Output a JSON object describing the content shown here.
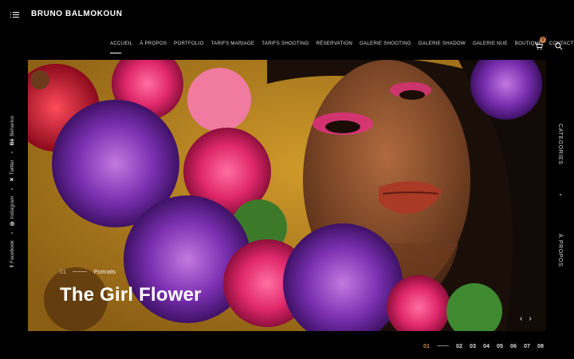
{
  "header": {
    "brand": "BRUNO BALMOKOUN",
    "nav": [
      "ACCUEIL",
      "À PROPOS",
      "PORTFOLIO",
      "TARIFS MARIAGE",
      "TARIFS SHOOTING",
      "RÉSERVATION",
      "GALERIE SHOOTING",
      "GALERIE SHADOW",
      "GALERIE NUE",
      "BOUTIQUE",
      "CONTACT"
    ],
    "cart_count": "0"
  },
  "social": [
    {
      "icon": "f",
      "label": "Facebook"
    },
    {
      "icon": "◎",
      "label": "Instagram"
    },
    {
      "icon": "✕",
      "label": "Twitter"
    },
    {
      "icon": "Bē",
      "label": "Behance"
    }
  ],
  "right_rail": {
    "top": "CATEGORIES",
    "bottom": "À PROPOS"
  },
  "slide": {
    "number": "01",
    "category": "Portraits",
    "title": "The Girl Flower"
  },
  "pagination": {
    "current": "01",
    "pages": [
      "02",
      "03",
      "04",
      "05",
      "06",
      "07",
      "08"
    ]
  },
  "colors": {
    "accent": "#c8844a",
    "hero_bg": "#b8841f",
    "flower_purple": "#7a2fb0",
    "flower_pink": "#e0286a"
  }
}
